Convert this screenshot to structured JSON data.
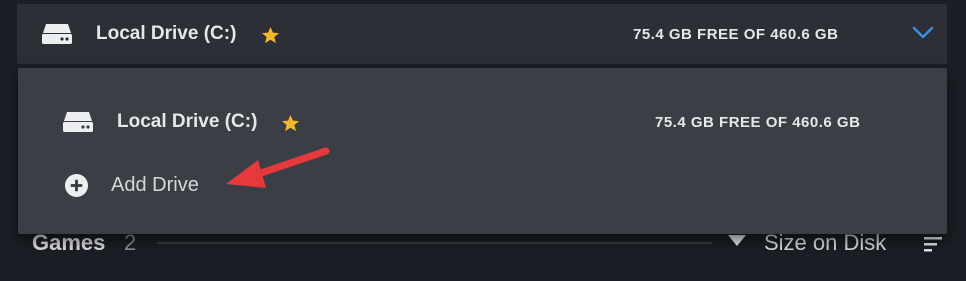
{
  "selector": {
    "drive_name": "Local Drive (C:)",
    "free_space": "75.4 GB FREE OF 460.6 GB",
    "expanded": true
  },
  "dropdown": {
    "items": [
      {
        "label": "Local Drive (C:)",
        "free_space": "75.4 GB FREE OF 460.6 GB",
        "icon": "drive-icon",
        "favorite": true
      },
      {
        "label": "Add Drive",
        "icon": "plus-circle-icon"
      }
    ]
  },
  "games": {
    "label": "Games",
    "count": "2",
    "sort_label": "Size on Disk"
  },
  "colors": {
    "background": "#1b1e24",
    "selector_bg": "#2c2f36",
    "dropdown_bg": "#3b3e45",
    "star": "#f2b92a",
    "chevron": "#3a8fe4",
    "annotation_arrow": "#e5393b"
  }
}
